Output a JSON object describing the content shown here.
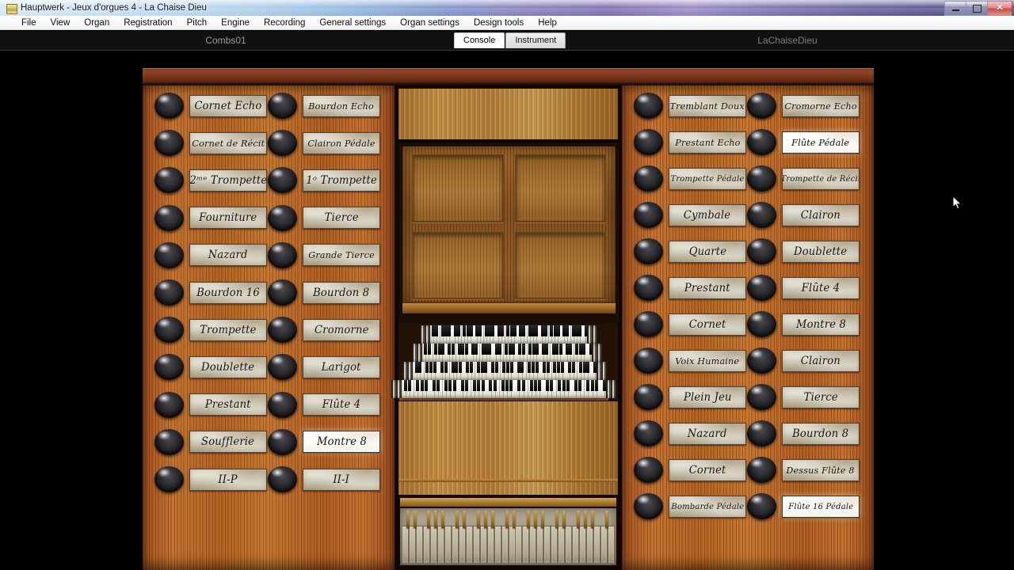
{
  "window": {
    "title": "Hauptwerk - Jeux d'orgues 4 - La Chaise Dieu",
    "app_icon": "hauptwerk-icon",
    "controls": {
      "minimize": "–",
      "restore": "❐",
      "close": "✕"
    }
  },
  "menubar": {
    "items": [
      {
        "label": "File"
      },
      {
        "label": "View"
      },
      {
        "label": "Organ"
      },
      {
        "label": "Registration"
      },
      {
        "label": "Pitch"
      },
      {
        "label": "Engine"
      },
      {
        "label": "Recording"
      },
      {
        "label": "General settings"
      },
      {
        "label": "Organ settings"
      },
      {
        "label": "Design tools"
      },
      {
        "label": "Help"
      }
    ]
  },
  "combbar": {
    "combination_set": "Combs01",
    "organ_name": "LaChaiseDieu",
    "tabs": [
      {
        "label": "Console",
        "active": true
      },
      {
        "label": "Instrument",
        "active": false
      }
    ]
  },
  "console": {
    "accent_wood_red": "#a8571f",
    "accent_wood_oak": "#b07a33",
    "top_rail_color": "#7e3d20",
    "knob_color": "#141416",
    "plate_color": "#dedbcd",
    "plate_on_color": "#ffffff",
    "manual_count": 4,
    "left_jamb": {
      "columns": [
        {
          "stops": [
            {
              "label": "Cornet Echo",
              "on": false,
              "size": "normal"
            },
            {
              "label": "Cornet de Récit",
              "on": false,
              "size": "tight"
            },
            {
              "label": "2ᵐᵉ Trompette",
              "on": false,
              "size": "normal"
            },
            {
              "label": "Fourniture",
              "on": false,
              "size": "normal"
            },
            {
              "label": "Nazard",
              "on": false,
              "size": "normal"
            },
            {
              "label": "Bourdon 16",
              "on": false,
              "size": "normal"
            },
            {
              "label": "Trompette",
              "on": false,
              "size": "normal"
            },
            {
              "label": "Doublette",
              "on": false,
              "size": "normal"
            },
            {
              "label": "Prestant",
              "on": false,
              "size": "normal"
            },
            {
              "label": "Soufflerie",
              "on": false,
              "size": "normal"
            },
            {
              "label": "II-P",
              "on": false,
              "size": "normal"
            }
          ]
        },
        {
          "stops": [
            {
              "label": "Bourdon Echo",
              "on": false,
              "size": "tight"
            },
            {
              "label": "Clairon Pédale",
              "on": false,
              "size": "tight"
            },
            {
              "label": "1ᵒ Trompette",
              "on": false,
              "size": "normal"
            },
            {
              "label": "Tierce",
              "on": false,
              "size": "normal"
            },
            {
              "label": "Grande Tierce",
              "on": false,
              "size": "tight"
            },
            {
              "label": "Bourdon 8",
              "on": false,
              "size": "normal"
            },
            {
              "label": "Cromorne",
              "on": false,
              "size": "normal"
            },
            {
              "label": "Larigot",
              "on": false,
              "size": "normal"
            },
            {
              "label": "Flûte 4",
              "on": false,
              "size": "normal"
            },
            {
              "label": "Montre 8",
              "on": true,
              "size": "normal"
            },
            {
              "label": "II-I",
              "on": false,
              "size": "normal"
            }
          ]
        }
      ]
    },
    "right_jamb": {
      "columns": [
        {
          "stops": [
            {
              "label": "Tremblant Doux",
              "on": false,
              "size": "tight"
            },
            {
              "label": "Prestant Echo",
              "on": false,
              "size": "tight"
            },
            {
              "label": "Trompette Pédale",
              "on": false,
              "size": "tighter"
            },
            {
              "label": "Cymbale",
              "on": false,
              "size": "normal"
            },
            {
              "label": "Quarte",
              "on": false,
              "size": "normal"
            },
            {
              "label": "Prestant",
              "on": false,
              "size": "normal"
            },
            {
              "label": "Cornet",
              "on": false,
              "size": "normal"
            },
            {
              "label": "Voix Humaine",
              "on": false,
              "size": "tight"
            },
            {
              "label": "Plein Jeu",
              "on": false,
              "size": "normal"
            },
            {
              "label": "Nazard",
              "on": false,
              "size": "normal"
            },
            {
              "label": "Cornet",
              "on": false,
              "size": "normal"
            },
            {
              "label": "Bombarde Pédale",
              "on": false,
              "size": "tighter"
            }
          ]
        },
        {
          "stops": [
            {
              "label": "Cromorne Echo",
              "on": false,
              "size": "tight"
            },
            {
              "label": "Flûte Pédale",
              "on": true,
              "size": "tight"
            },
            {
              "label": "Trompette de Récit",
              "on": false,
              "size": "tighter"
            },
            {
              "label": "Clairon",
              "on": false,
              "size": "normal"
            },
            {
              "label": "Doublette",
              "on": false,
              "size": "normal"
            },
            {
              "label": "Flûte 4",
              "on": false,
              "size": "normal"
            },
            {
              "label": "Montre 8",
              "on": false,
              "size": "normal"
            },
            {
              "label": "Clairon",
              "on": false,
              "size": "normal"
            },
            {
              "label": "Tierce",
              "on": false,
              "size": "normal"
            },
            {
              "label": "Bourdon 8",
              "on": false,
              "size": "normal"
            },
            {
              "label": "Dessus Flûte 8",
              "on": false,
              "size": "tight"
            },
            {
              "label": "Flûte 16 Pédale",
              "on": true,
              "size": "tighter"
            }
          ]
        }
      ]
    }
  }
}
